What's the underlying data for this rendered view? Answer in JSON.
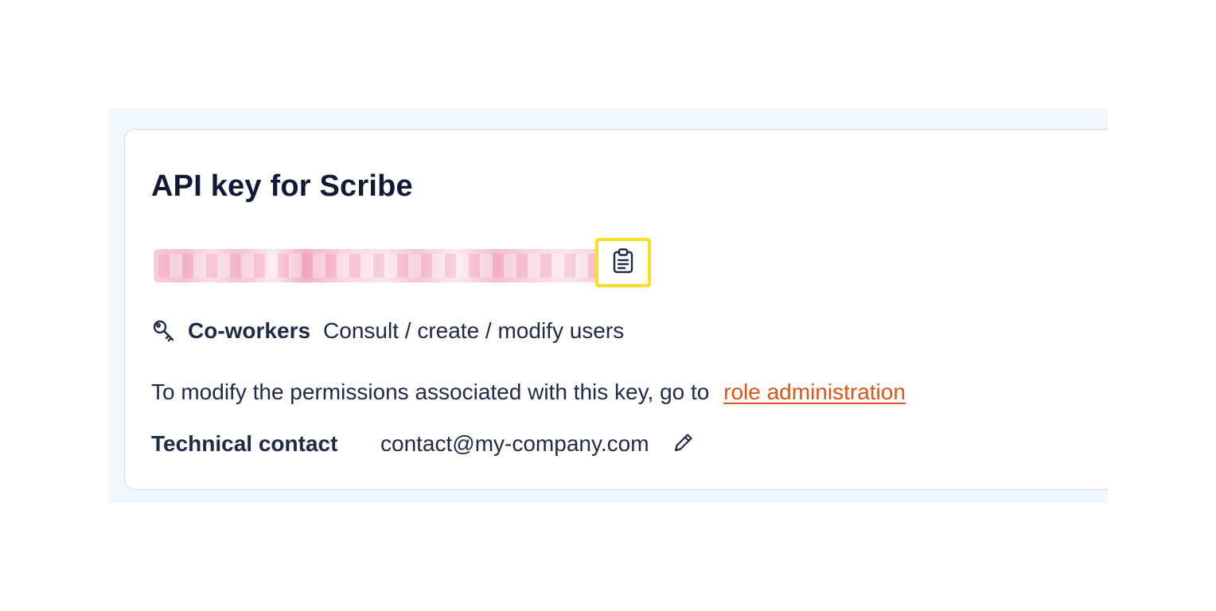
{
  "card": {
    "title": "API key for Scribe"
  },
  "api_key": {
    "copy_icon": "clipboard-icon"
  },
  "permission": {
    "icon": "key-icon",
    "name": "Co-workers",
    "description": "Consult / create / modify users"
  },
  "modify": {
    "text": "To modify the permissions associated with this key, go to",
    "link_label": "role administration",
    "link_color": "#d9541e"
  },
  "contact": {
    "label": "Technical contact",
    "value": "contact@my-company.com",
    "edit_icon": "pencil-icon"
  },
  "colors": {
    "highlight": "#f7df2a",
    "panel_background": "#f2f6fd"
  }
}
